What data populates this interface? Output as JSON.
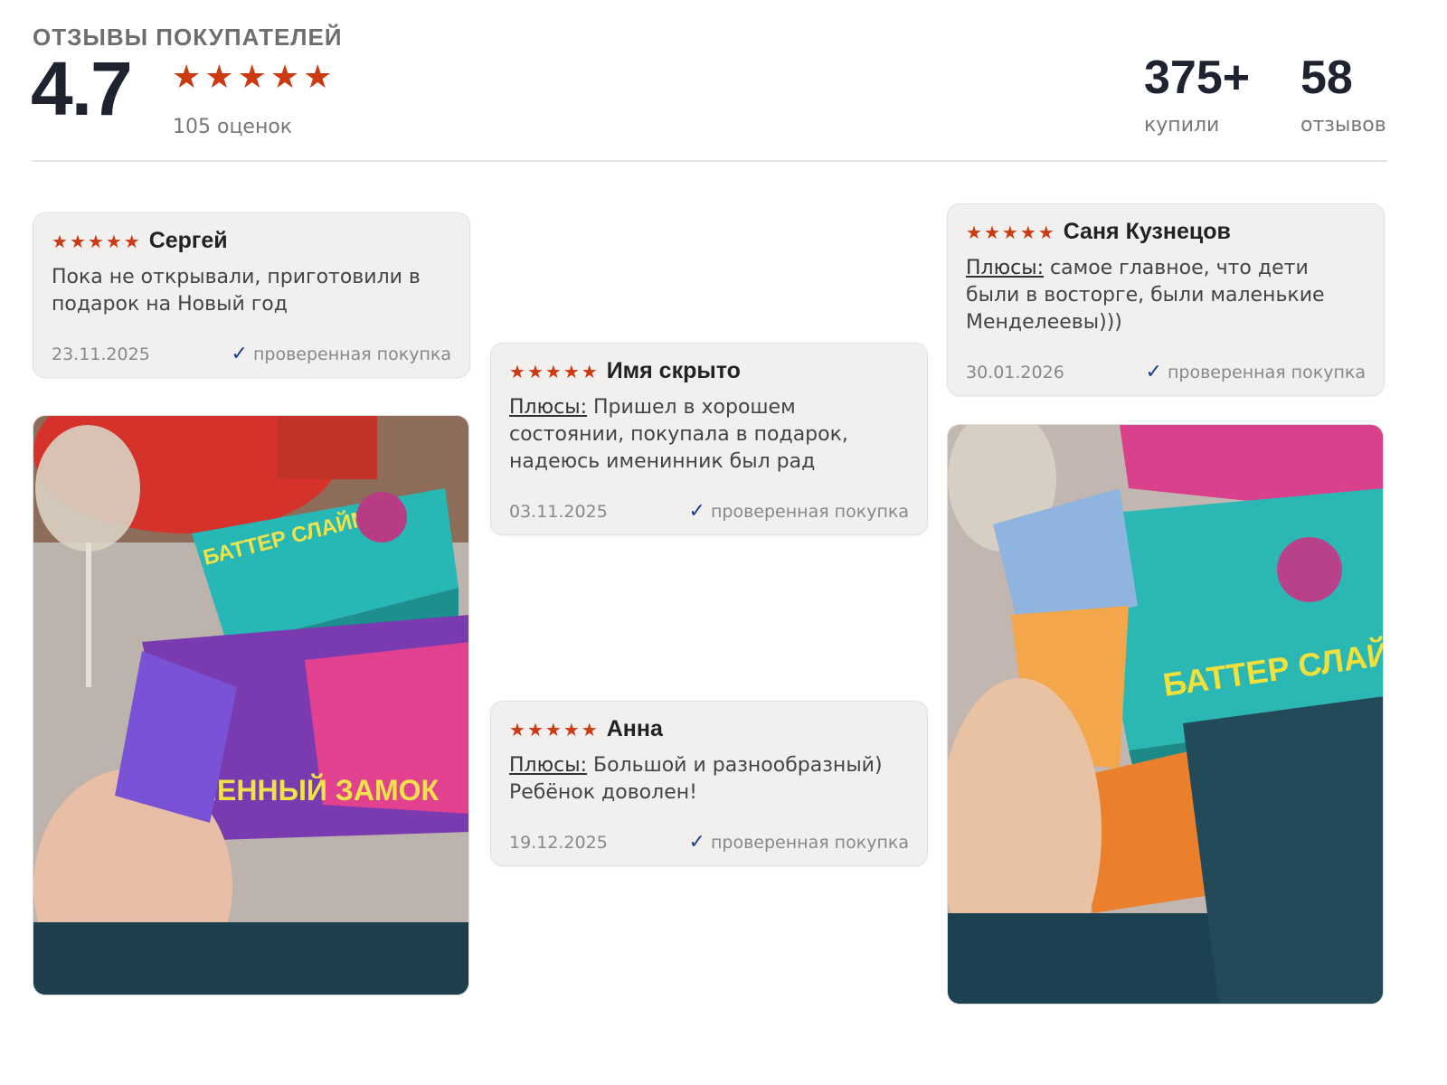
{
  "header": {
    "title": "ОТЗЫВЫ ПОКУПАТЕЛЕЙ",
    "rating": "4.7",
    "ratings_count": "105 оценок",
    "stats": {
      "bought_value": "375+",
      "bought_label": "купили",
      "reviews_value": "58",
      "reviews_label": "отзывов"
    },
    "star_color": "#cc3a12"
  },
  "reviews": [
    {
      "author": "Сергей",
      "rating": 5,
      "pluses_label": "",
      "text": "Пока не открывали, приготовили в подарок на Новый год",
      "date": "23.11.2025",
      "verified": "проверенная покупка"
    },
    {
      "author": "Имя скрыто",
      "rating": 5,
      "pluses_label": "Плюсы:",
      "text": "Пришел в хорошем состоянии, покупала в подарок, надеюсь именинник был рад",
      "date": "03.11.2025",
      "verified": "проверенная покупка"
    },
    {
      "author": "Саня Кузнецов",
      "rating": 5,
      "pluses_label": "Плюсы:",
      "text": "самое главное, что дети были в восторге, были маленькие Менделеевы)))",
      "date": "30.01.2026",
      "verified": "проверенная покупка"
    },
    {
      "author": "Анна",
      "rating": 5,
      "pluses_label": "Плюсы:",
      "text": "Большой и разнообразный) Ребёнок доволен!",
      "date": "19.12.2025",
      "verified": "проверенная покупка"
    }
  ],
  "photos": [
    {
      "icon": "review-photo",
      "box_text": [
        "БАТТЕР СЛАЙМ",
        "ПЕННЫЙ ЗАМОК"
      ]
    },
    {
      "icon": "review-photo",
      "box_text": [
        "БАТТЕР СЛАЙМ"
      ]
    }
  ]
}
